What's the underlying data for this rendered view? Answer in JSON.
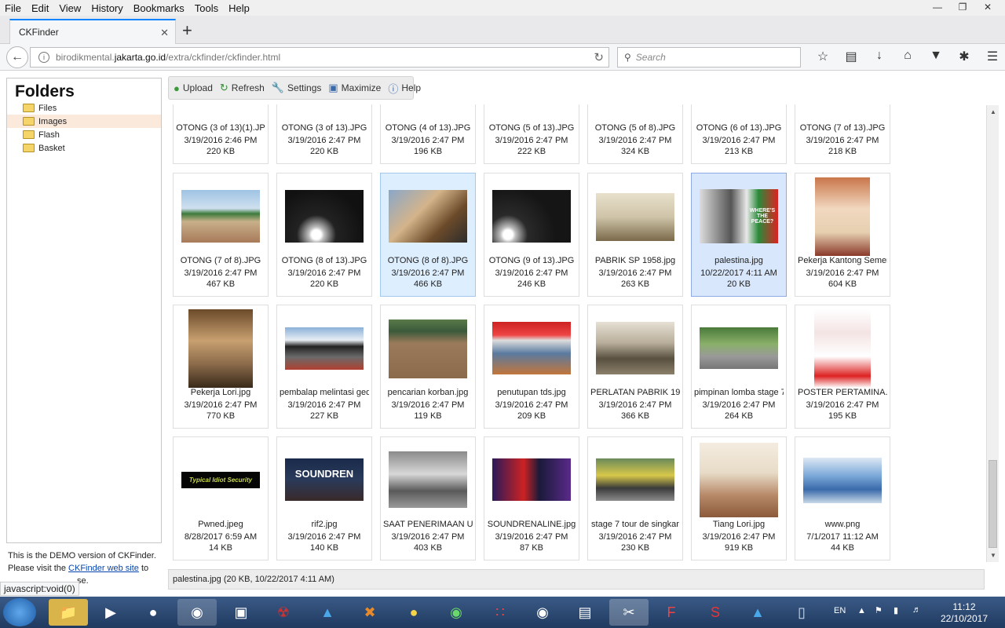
{
  "browser": {
    "menu": [
      "File",
      "Edit",
      "View",
      "History",
      "Bookmarks",
      "Tools",
      "Help"
    ],
    "tab_title": "CKFinder",
    "url_prefix": "birodikmental.",
    "url_domain": "jakarta.go.id",
    "url_path": "/extra/ckfinder/ckfinder.html",
    "search_placeholder": "Search",
    "status_url": "javascript:void(0)"
  },
  "sidebar": {
    "title": "Folders",
    "folders": [
      "Files",
      "Images",
      "Flash",
      "Basket"
    ],
    "selected_folder": "Images",
    "demo_line1": "This is the DEMO version of CKFinder.",
    "demo_line2": "Please visit the",
    "demo_link": "CKFinder web site",
    "demo_line3": "to",
    "demo_line4": "se."
  },
  "toolbar": {
    "upload": "Upload",
    "refresh": "Refresh",
    "settings": "Settings",
    "maximize": "Maximize",
    "help": "Help"
  },
  "files": [
    {
      "name": "OTONG (3 of 13)(1).JP",
      "date": "3/19/2016 2:46 PM",
      "size": "220 KB"
    },
    {
      "name": "OTONG (3 of 13).JPG",
      "date": "3/19/2016 2:47 PM",
      "size": "220 KB"
    },
    {
      "name": "OTONG (4 of 13).JPG",
      "date": "3/19/2016 2:47 PM",
      "size": "196 KB"
    },
    {
      "name": "OTONG (5 of 13).JPG",
      "date": "3/19/2016 2:47 PM",
      "size": "222 KB"
    },
    {
      "name": "OTONG (5 of 8).JPG",
      "date": "3/19/2016 2:47 PM",
      "size": "324 KB"
    },
    {
      "name": "OTONG (6 of 13).JPG",
      "date": "3/19/2016 2:47 PM",
      "size": "213 KB"
    },
    {
      "name": "OTONG (7 of 13).JPG",
      "date": "3/19/2016 2:47 PM",
      "size": "218 KB"
    },
    {
      "name": "OTONG (7 of 8).JPG",
      "date": "3/19/2016 2:47 PM",
      "size": "467 KB"
    },
    {
      "name": "OTONG (8 of 13).JPG",
      "date": "3/19/2016 2:47 PM",
      "size": "220 KB"
    },
    {
      "name": "OTONG (8 of 8).JPG",
      "date": "3/19/2016 2:47 PM",
      "size": "466 KB"
    },
    {
      "name": "OTONG (9 of 13).JPG",
      "date": "3/19/2016 2:47 PM",
      "size": "246 KB"
    },
    {
      "name": "PABRIK SP 1958.jpg",
      "date": "3/19/2016 2:47 PM",
      "size": "263 KB"
    },
    {
      "name": "palestina.jpg",
      "date": "10/22/2017 4:11 AM",
      "size": "20 KB"
    },
    {
      "name": "Pekerja Kantong Semen",
      "date": "3/19/2016 2:47 PM",
      "size": "604 KB"
    },
    {
      "name": "Pekerja Lori.jpg",
      "date": "3/19/2016 2:47 PM",
      "size": "770 KB"
    },
    {
      "name": "pembalap melintasi ged",
      "date": "3/19/2016 2:47 PM",
      "size": "227 KB"
    },
    {
      "name": "pencarian korban.jpg",
      "date": "3/19/2016 2:47 PM",
      "size": "119 KB"
    },
    {
      "name": "penutupan tds.jpg",
      "date": "3/19/2016 2:47 PM",
      "size": "209 KB"
    },
    {
      "name": "PERLATAN PABRIK 191",
      "date": "3/19/2016 2:47 PM",
      "size": "366 KB"
    },
    {
      "name": "pimpinan lomba stage 7",
      "date": "3/19/2016 2:47 PM",
      "size": "264 KB"
    },
    {
      "name": "POSTER PERTAMINA.jp",
      "date": "3/19/2016 2:47 PM",
      "size": "195 KB"
    },
    {
      "name": "Pwned.jpeg",
      "date": "8/28/2017 6:59 AM",
      "size": "14 KB"
    },
    {
      "name": "rif2.jpg",
      "date": "3/19/2016 2:47 PM",
      "size": "140 KB"
    },
    {
      "name": "SAAT PENERIMAAN UP",
      "date": "3/19/2016 2:47 PM",
      "size": "403 KB"
    },
    {
      "name": "SOUNDRENALINE.jpg",
      "date": "3/19/2016 2:47 PM",
      "size": "87 KB"
    },
    {
      "name": "stage 7 tour de singkar",
      "date": "3/19/2016 2:47 PM",
      "size": "230 KB"
    },
    {
      "name": "Tiang Lori.jpg",
      "date": "3/19/2016 2:47 PM",
      "size": "919 KB"
    },
    {
      "name": "www.png",
      "date": "7/1/2017 11:12 AM",
      "size": "44 KB"
    }
  ],
  "thumb_text": {
    "pwned": "Typical Idiot Security",
    "soundrenaline": "SOUNDREN",
    "palestina": "WHERE'S THE PEACE?"
  },
  "selected_info": "palestina.jpg (20 KB, 10/22/2017 4:11 AM)",
  "taskbar": {
    "lang": "EN",
    "time": "11:12",
    "date": "22/10/2017"
  }
}
